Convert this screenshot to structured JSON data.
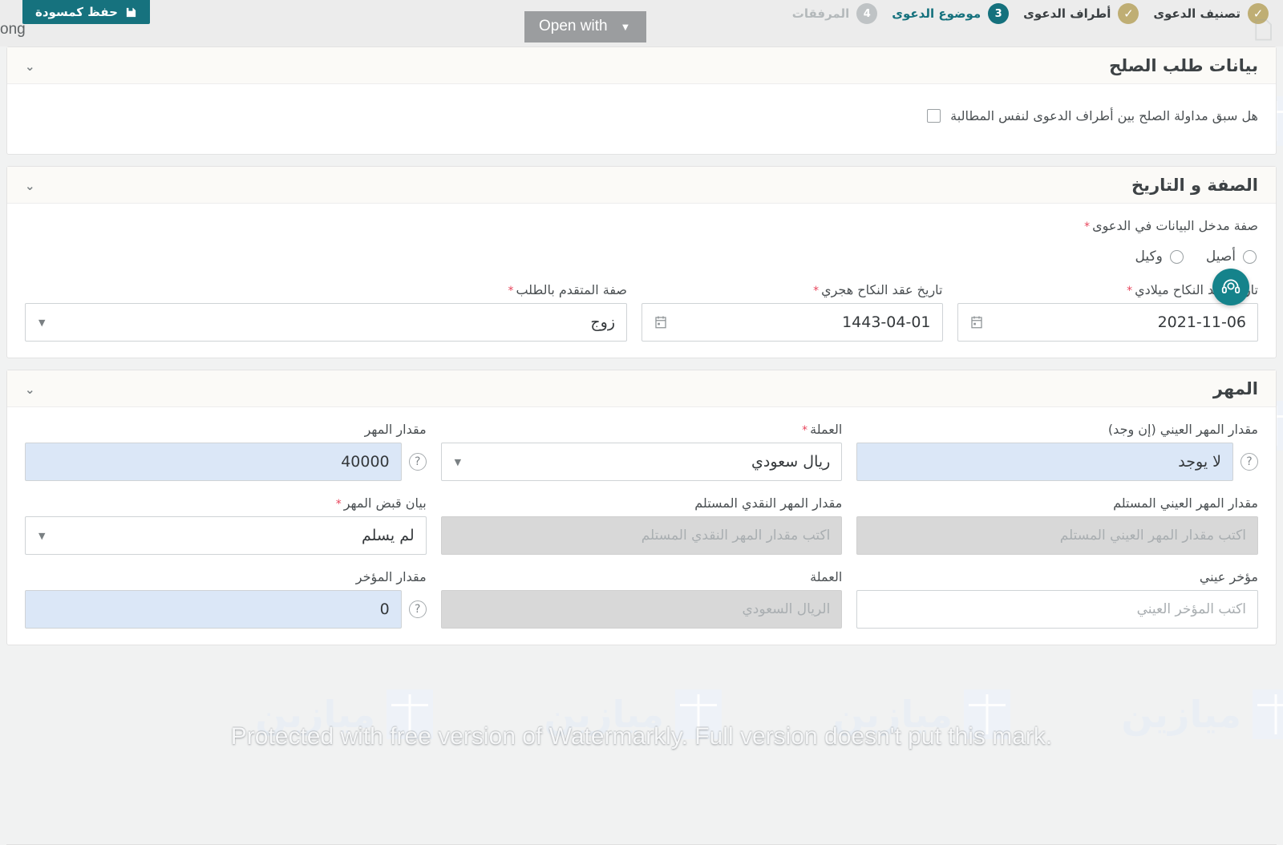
{
  "topbar": {
    "save_draft_label": "حفظ كمسودة",
    "save_icon": "floppy-disk-icon",
    "fragment_text": "ong",
    "open_with_label": "Open with",
    "open_with_caret": "▼",
    "steps": [
      {
        "label": "تصنيف الدعوى",
        "badge": "✓",
        "state": "done"
      },
      {
        "label": "أطراف الدعوى",
        "badge": "✓",
        "state": "done"
      },
      {
        "label": "موضوع الدعوى",
        "badge": "3",
        "state": "active"
      },
      {
        "label": "المرفقات",
        "badge": "4",
        "state": "todo"
      }
    ]
  },
  "colors": {
    "accent_teal": "#15717d",
    "step_done": "#bfae74",
    "step_todo": "#bfc3c5",
    "required_red": "#e8455c",
    "highlight_blue": "#dbe7f7",
    "disabled_gray": "#d8d8d8"
  },
  "sections": {
    "reconciliation": {
      "title": "بيانات طلب الصلح",
      "collapse_icon": "chevron-up-icon",
      "checkbox_label": "هل سبق مداولة الصلح بين أطراف الدعوى لنفس المطالبة",
      "checkbox_checked": false
    },
    "capacity_date": {
      "title": "الصفة و التاريخ",
      "collapse_icon": "chevron-up-icon",
      "entrant_capacity": {
        "label": "صفة مدخل البيانات في الدعوى",
        "required": true,
        "options": [
          {
            "label": "أصيل",
            "selected": false
          },
          {
            "label": "وكيل",
            "selected": false
          }
        ]
      },
      "applicant_capacity": {
        "label": "صفة المتقدم بالطلب",
        "required": true,
        "value": "زوج",
        "caret": "▼"
      },
      "marriage_date_hijri": {
        "label": "تاريخ عقد النكاح هجري",
        "required": true,
        "value": "1443-04-01",
        "icon": "calendar-icon"
      },
      "marriage_date_gregorian": {
        "label": "تاريخ عقد النكاح ميلادي",
        "required": true,
        "value": "2021-11-06",
        "icon": "calendar-icon"
      }
    },
    "dowry": {
      "title": "المهر",
      "collapse_icon": "chevron-up-icon",
      "dowry_amount": {
        "label": "مقدار المهر",
        "required": false,
        "value": "40000",
        "help_icon": "question-mark-icon"
      },
      "currency": {
        "label": "العملة",
        "required": true,
        "value": "ريال سعودي",
        "caret": "▼"
      },
      "in_kind_dowry": {
        "label": "مقدار المهر العيني (إن وجد)",
        "required": false,
        "value": "لا يوجد",
        "help_icon": "question-mark-icon"
      },
      "dowry_receipt_statement": {
        "label": "بيان قبض المهر",
        "required": true,
        "value": "لم يسلم",
        "caret": "▼"
      },
      "received_cash_dowry": {
        "label": "مقدار المهر النقدي المستلم",
        "required": false,
        "placeholder": "اكتب مقدار المهر النقدي المستلم",
        "value": "",
        "disabled": true
      },
      "received_in_kind_dowry": {
        "label": "مقدار المهر العيني المستلم",
        "required": false,
        "placeholder": "اكتب مقدار المهر العيني المستلم",
        "value": "",
        "disabled": true
      },
      "deferred_amount": {
        "label": "مقدار المؤخر",
        "required": false,
        "value": "0",
        "help_icon": "question-mark-icon"
      },
      "deferred_currency": {
        "label": "العملة",
        "required": false,
        "value": "",
        "placeholder": "الريال السعودي",
        "disabled": true
      },
      "deferred_in_kind": {
        "label": "مؤخر عيني",
        "required": false,
        "placeholder": "اكتب المؤخر العيني",
        "value": ""
      }
    }
  },
  "support_fab": {
    "icon": "headset-agent-icon"
  },
  "overlay": {
    "watermarkly_text": "Protected with free version of Watermarkly. Full version doesn't put this mark.",
    "background_watermark_text": "ميازين"
  }
}
